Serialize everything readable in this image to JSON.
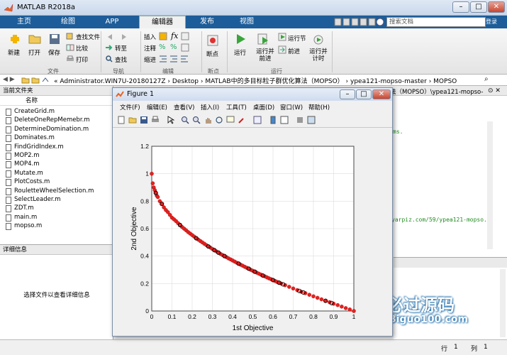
{
  "window": {
    "title": "MATLAB R2018a"
  },
  "tabs": [
    {
      "label": "主页"
    },
    {
      "label": "绘图"
    },
    {
      "label": "APP"
    },
    {
      "label": "编辑器"
    },
    {
      "label": "发布"
    },
    {
      "label": "视图"
    }
  ],
  "search": {
    "placeholder": "搜索文档",
    "login": "登录"
  },
  "ribbon": {
    "file": {
      "new": "新建",
      "open": "打开",
      "save": "保存",
      "find_files": "查找文件",
      "compare": "比较",
      "print": "打印",
      "group": "文件"
    },
    "navigate": {
      "goto": "转至",
      "find": "查找",
      "group": "导航"
    },
    "edit": {
      "insert": "插入",
      "comment": "注释",
      "indent": "缩进",
      "group": "编辑"
    },
    "breakpoints": {
      "breakpoints": "断点",
      "group": "断点"
    },
    "run": {
      "run": "运行",
      "run_advance": "运行并前进",
      "run_section": "运行节",
      "advance": "前进",
      "run_time": "运行并计时",
      "group": "运行"
    }
  },
  "address": {
    "path": "« Administrator.WIN7U-20180127Z  ›  Desktop  ›  MATLAB中的多目标粒子群优化算法（MOPSO）  ›  ypea121-mopso-master  ›  MOPSO"
  },
  "file_panel": {
    "title": "当前文件夹",
    "column_name": "名称",
    "files": [
      "CreateGrid.m",
      "DeleteOneRepMemebr.m",
      "DetermineDomination.m",
      "Dominates.m",
      "FindGridIndex.m",
      "MOP2.m",
      "MOP4.m",
      "Mutate.m",
      "PlotCosts.m",
      "RouletteWheelSelection.m",
      "SelectLeader.m",
      "ZDT.m",
      "main.m",
      "mopso.m"
    ]
  },
  "detail_panel": {
    "title": "详细信息",
    "message": "选择文件以查看详细信息"
  },
  "editor": {
    "path_fragment": "法（MOPSO）\\ypea121-mopso-",
    "fragment1": "ms.",
    "fragment2": "yarpiz.com/59/ypea121-mopso."
  },
  "figure": {
    "title": "Figure 1",
    "menu": [
      "文件(F)",
      "编辑(E)",
      "查看(V)",
      "插入(I)",
      "工具(T)",
      "桌面(D)",
      "窗口(W)",
      "帮助(H)"
    ]
  },
  "status": {
    "row_label": "行",
    "row": "1",
    "col_label": "列",
    "col": "1"
  },
  "watermark": {
    "brand": "必过源码",
    "url": "Biguo100.com"
  },
  "chart_data": {
    "type": "scatter",
    "xlabel": "1st Objective",
    "ylabel": "2nd Objective",
    "xlim": [
      0,
      1
    ],
    "ylim": [
      0,
      1.2
    ],
    "xticks": [
      "0",
      "0.1",
      "0.2",
      "0.3",
      "0.4",
      "0.5",
      "0.6",
      "0.7",
      "0.8",
      "0.9",
      "1"
    ],
    "yticks": [
      "0",
      "0.2",
      "0.4",
      "0.6",
      "0.8",
      "1",
      "1.2"
    ],
    "grid": true,
    "series": [
      {
        "marker": "filled-circle",
        "color": "#e8201e",
        "points": [
          [
            0.0,
            1.0
          ],
          [
            0.005,
            0.93
          ],
          [
            0.01,
            0.9
          ],
          [
            0.015,
            0.88
          ],
          [
            0.02,
            0.86
          ],
          [
            0.025,
            0.84
          ],
          [
            0.03,
            0.83
          ],
          [
            0.04,
            0.8
          ],
          [
            0.05,
            0.78
          ],
          [
            0.06,
            0.755
          ],
          [
            0.07,
            0.735
          ],
          [
            0.08,
            0.72
          ],
          [
            0.09,
            0.7
          ],
          [
            0.1,
            0.68
          ],
          [
            0.11,
            0.668
          ],
          [
            0.12,
            0.655
          ],
          [
            0.13,
            0.64
          ],
          [
            0.14,
            0.625
          ],
          [
            0.15,
            0.612
          ],
          [
            0.16,
            0.6
          ],
          [
            0.17,
            0.588
          ],
          [
            0.18,
            0.575
          ],
          [
            0.19,
            0.564
          ],
          [
            0.2,
            0.553
          ],
          [
            0.21,
            0.542
          ],
          [
            0.22,
            0.53
          ],
          [
            0.23,
            0.52
          ],
          [
            0.24,
            0.51
          ],
          [
            0.25,
            0.5
          ],
          [
            0.26,
            0.49
          ],
          [
            0.27,
            0.48
          ],
          [
            0.28,
            0.47
          ],
          [
            0.29,
            0.462
          ],
          [
            0.3,
            0.452
          ],
          [
            0.31,
            0.443
          ],
          [
            0.32,
            0.434
          ],
          [
            0.33,
            0.425
          ],
          [
            0.34,
            0.416
          ],
          [
            0.35,
            0.408
          ],
          [
            0.36,
            0.4
          ],
          [
            0.37,
            0.392
          ],
          [
            0.38,
            0.383
          ],
          [
            0.39,
            0.376
          ],
          [
            0.4,
            0.368
          ],
          [
            0.41,
            0.36
          ],
          [
            0.42,
            0.352
          ],
          [
            0.43,
            0.345
          ],
          [
            0.44,
            0.337
          ],
          [
            0.45,
            0.33
          ],
          [
            0.46,
            0.322
          ],
          [
            0.47,
            0.315
          ],
          [
            0.48,
            0.308
          ],
          [
            0.49,
            0.3
          ],
          [
            0.5,
            0.293
          ],
          [
            0.51,
            0.286
          ],
          [
            0.52,
            0.279
          ],
          [
            0.53,
            0.272
          ],
          [
            0.54,
            0.265
          ],
          [
            0.55,
            0.258
          ],
          [
            0.56,
            0.252
          ],
          [
            0.57,
            0.245
          ],
          [
            0.58,
            0.238
          ],
          [
            0.59,
            0.232
          ],
          [
            0.6,
            0.225
          ],
          [
            0.61,
            0.219
          ],
          [
            0.62,
            0.212
          ],
          [
            0.63,
            0.206
          ],
          [
            0.64,
            0.2
          ],
          [
            0.66,
            0.188
          ],
          [
            0.68,
            0.176
          ],
          [
            0.7,
            0.164
          ],
          [
            0.72,
            0.152
          ],
          [
            0.74,
            0.14
          ],
          [
            0.76,
            0.13
          ],
          [
            0.78,
            0.118
          ],
          [
            0.8,
            0.107
          ],
          [
            0.82,
            0.096
          ],
          [
            0.84,
            0.085
          ],
          [
            0.86,
            0.074
          ],
          [
            0.88,
            0.064
          ],
          [
            0.9,
            0.053
          ],
          [
            0.92,
            0.043
          ],
          [
            0.94,
            0.032
          ],
          [
            0.96,
            0.021
          ],
          [
            0.98,
            0.011
          ],
          [
            1.0,
            0.0
          ]
        ]
      },
      {
        "marker": "open-circle",
        "color": "#000000",
        "points": [
          [
            0.02,
            0.86
          ],
          [
            0.05,
            0.78
          ],
          [
            0.14,
            0.626
          ],
          [
            0.22,
            0.53
          ],
          [
            0.28,
            0.47
          ],
          [
            0.31,
            0.443
          ],
          [
            0.33,
            0.425
          ],
          [
            0.36,
            0.4
          ],
          [
            0.43,
            0.345
          ],
          [
            0.48,
            0.308
          ],
          [
            0.51,
            0.286
          ],
          [
            0.55,
            0.258
          ],
          [
            0.6,
            0.225
          ],
          [
            0.63,
            0.206
          ],
          [
            0.65,
            0.194
          ],
          [
            0.73,
            0.146
          ],
          [
            0.75,
            0.135
          ],
          [
            0.86,
            0.074
          ],
          [
            0.89,
            0.058
          ]
        ]
      }
    ]
  }
}
